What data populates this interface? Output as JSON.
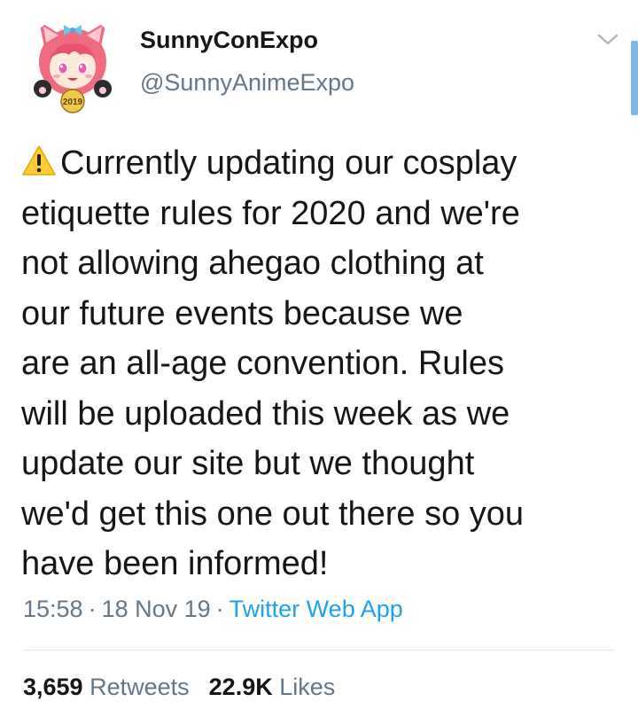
{
  "author": {
    "display_name": "SunnyConExpo",
    "handle": "@SunnyAnimeExpo",
    "avatar_text": "2019"
  },
  "tweet": {
    "icon": "warning-icon",
    "lines": [
      "Currently updating our cosplay",
      "etiquette rules for 2020 and we're",
      "not allowing ahegao clothing at",
      "our future events because we",
      "are an all-age convention. Rules",
      "will be uploaded this week as we",
      "update our site but we thought",
      "we'd get this one out there so you",
      "have been informed!"
    ]
  },
  "meta": {
    "time": "15:58",
    "separator": "·",
    "date": "18 Nov 19",
    "source": "Twitter Web App"
  },
  "stats": {
    "retweets_count": "3,659",
    "retweets_label": "Retweets",
    "likes_count": "22.9K",
    "likes_label": "Likes"
  },
  "colors": {
    "text": "#14171a",
    "secondary": "#657786",
    "link": "#1da1f2",
    "divider": "#e1e8ed"
  }
}
